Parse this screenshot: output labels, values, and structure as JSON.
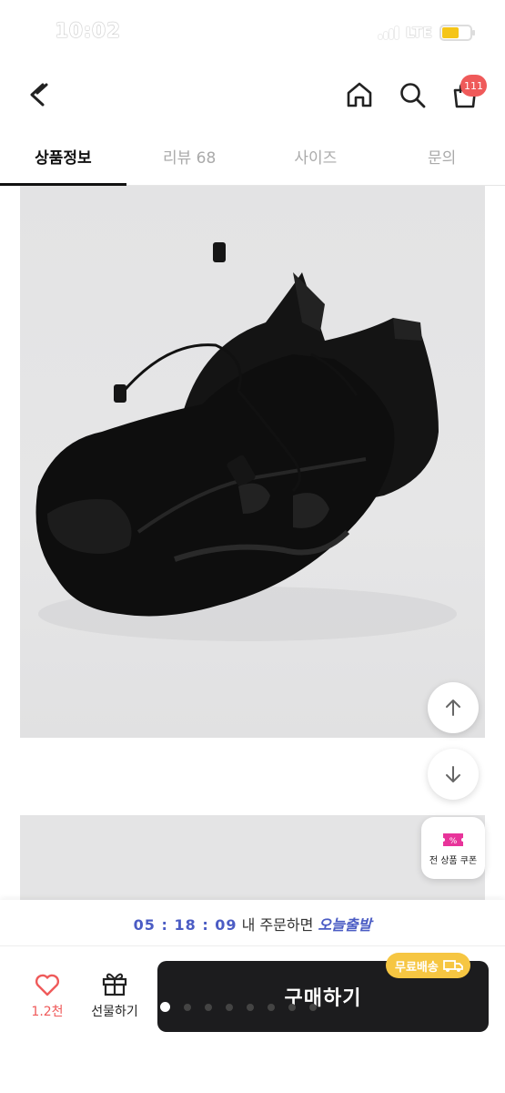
{
  "status_bar": {
    "time": "10:02",
    "network": "LTE",
    "battery_color": "#f5c518"
  },
  "header": {
    "back_icon": "chevron-left-icon",
    "icons": [
      "home-icon",
      "search-icon",
      "shopping-bag-icon"
    ],
    "cart_count": "111"
  },
  "tabs": [
    {
      "label": "상품정보",
      "active": true
    },
    {
      "label": "리뷰 68",
      "active": false
    },
    {
      "label": "사이즈",
      "active": false
    },
    {
      "label": "문의",
      "active": false
    }
  ],
  "floating": {
    "scroll_up_icon": "arrow-up-icon",
    "scroll_down_icon": "arrow-down-icon",
    "coupon_label": "전 상품 쿠폰"
  },
  "bottom": {
    "timer": "05 : 18 : 09",
    "deadline_text": "내 주문하면",
    "today_ship": "오늘출발",
    "like_count": "1.2천",
    "gift_label": "선물하기",
    "buy_label": "구매하기",
    "free_ship_label": "무료배송",
    "accent_color": "#4b5cc4",
    "like_color": "#ef5a5a",
    "free_ship_color": "#f6c642"
  }
}
